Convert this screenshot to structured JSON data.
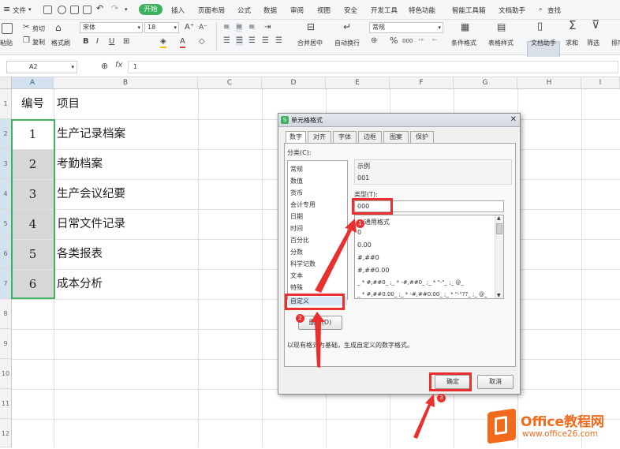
{
  "menu": {
    "file": "文件",
    "start": "开始",
    "items": [
      "插入",
      "页面布局",
      "公式",
      "数据",
      "审阅",
      "视图",
      "安全",
      "开发工具",
      "特色功能",
      "智能工具箱",
      "文档助手"
    ],
    "search": "查找"
  },
  "ribbon": {
    "paste": "粘贴",
    "cut": "剪切",
    "copy": "复制",
    "format_painter": "格式刷",
    "font_name": "宋体",
    "font_size": "18",
    "merge_center": "合并居中",
    "wrap_text": "自动换行",
    "number_format": "常规",
    "conditional_format": "条件格式",
    "table_style": "表格样式",
    "doc_helper": "文档助手",
    "sum": "求和",
    "filter": "筛选",
    "sort": "排序"
  },
  "formula_bar": {
    "cell_ref": "A2",
    "fx": "fx",
    "value": "1"
  },
  "columns": [
    "A",
    "B",
    "C",
    "D",
    "E",
    "F",
    "G",
    "H",
    "I"
  ],
  "rows": [
    "1",
    "2",
    "3",
    "4",
    "5",
    "6",
    "7",
    "8",
    "9",
    "10",
    "11",
    "12"
  ],
  "sheet": {
    "header": {
      "a": "编号",
      "b": "项目"
    },
    "data": [
      {
        "a": "1",
        "b": "生产记录档案"
      },
      {
        "a": "2",
        "b": "考勤档案"
      },
      {
        "a": "3",
        "b": "生产会议纪要"
      },
      {
        "a": "4",
        "b": "日常文件记录"
      },
      {
        "a": "5",
        "b": "各类报表"
      },
      {
        "a": "6",
        "b": "成本分析"
      }
    ]
  },
  "dialog": {
    "title": "单元格格式",
    "tabs": [
      "数字",
      "对齐",
      "字体",
      "边框",
      "图案",
      "保护"
    ],
    "category_label": "分类(C):",
    "categories": [
      "常规",
      "数值",
      "货币",
      "会计专用",
      "日期",
      "时间",
      "百分比",
      "分数",
      "科学记数",
      "文本",
      "特殊",
      "自定义"
    ],
    "sample_label": "示例",
    "sample_value": "001",
    "type_label": "类型(T):",
    "type_value": "000",
    "formats": [
      "G/通用格式",
      "0",
      "0.00",
      "#,##0",
      "#,##0.00",
      "_ * #,##0_ ;_ * -#,##0_ ;_ * \"-\"_ ;_ @_",
      "_ * #,##0.00_ ;_ * -#,##0.00_ ;_ * \"-\"??_ ;_ @_"
    ],
    "delete_btn": "删除(D)",
    "description": "以现有格式为基础，生成自定义的数字格式。",
    "ok": "确定",
    "cancel": "取消"
  },
  "annotations": [
    "1",
    "2",
    "3"
  ],
  "watermark": {
    "brand": "Office教程网",
    "url": "www.office26.com"
  },
  "colors": {
    "accent_green": "#3eb15e",
    "annotation_red": "#e8312f",
    "watermark_orange": "#f26b1d"
  }
}
